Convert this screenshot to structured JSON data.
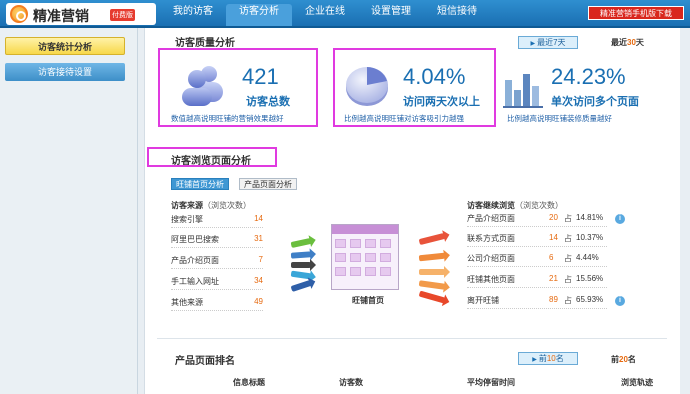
{
  "app": {
    "title": "精准营销",
    "badge": "付费版"
  },
  "nav": {
    "tabs": [
      "我的访客",
      "访客分析",
      "企业在线",
      "设置管理",
      "短信接待"
    ],
    "active": 1
  },
  "mobile_download": "精准营销手机版下载",
  "sidebar": {
    "items": [
      {
        "label": "访客统计分析",
        "active": true
      },
      {
        "label": "访客接待设置",
        "active": false
      }
    ]
  },
  "quality": {
    "title": "访客质量分析",
    "range_selected": "最近7天",
    "range_other_prefix": "最近",
    "range_other_num": "30",
    "range_other_suffix": "天",
    "stats": [
      {
        "value": "421",
        "label": "访客总数",
        "note": "数值越高说明旺铺的营销效果越好"
      },
      {
        "value": "4.04%",
        "label": "访问两天次以上",
        "note": "比例越高说明旺铺对访客吸引力越强"
      },
      {
        "value": "24.23%",
        "label": "单次访问多个页面",
        "note": "比例越高说明旺铺装修质量越好"
      }
    ]
  },
  "browse": {
    "title": "访客浏览页面分析",
    "subtabs": [
      "旺铺首页分析",
      "产品页面分析"
    ],
    "sources_header": "访客来源",
    "sources_sub": "（浏览次数）",
    "sources": [
      {
        "name": "搜索引擎",
        "value": "14"
      },
      {
        "name": "阿里巴巴搜索",
        "value": "31"
      },
      {
        "name": "产品介绍页面",
        "value": "7"
      },
      {
        "name": "手工输入网址",
        "value": "34"
      },
      {
        "name": "其他来源",
        "value": "49"
      }
    ],
    "center_label": "旺铺首页",
    "next_header": "访客继续浏览",
    "next_sub": "（浏览次数）",
    "pct_prefix": "占",
    "next": [
      {
        "name": "产品介绍页面",
        "count": "20",
        "pct": "14.81%",
        "info": true
      },
      {
        "name": "联系方式页面",
        "count": "14",
        "pct": "10.37%",
        "info": false
      },
      {
        "name": "公司介绍页面",
        "count": "6",
        "pct": "4.44%",
        "info": false
      },
      {
        "name": "旺铺其他页面",
        "count": "21",
        "pct": "15.56%",
        "info": false
      },
      {
        "name": "离开旺铺",
        "count": "89",
        "pct": "65.93%",
        "info": true
      }
    ]
  },
  "ranking": {
    "title": "产品页面排名",
    "top_selected_prefix": "前",
    "top_selected_num": "10",
    "top_selected_suffix": "名",
    "top_other_prefix": "前",
    "top_other_num": "20",
    "top_other_suffix": "名",
    "columns": [
      "信息标题",
      "访客数",
      "平均停留时间",
      "浏览轨迹"
    ]
  },
  "colors": {
    "accent": "#1a6fb2",
    "highlight": "#e03ae0",
    "orange": "#e66a10"
  }
}
